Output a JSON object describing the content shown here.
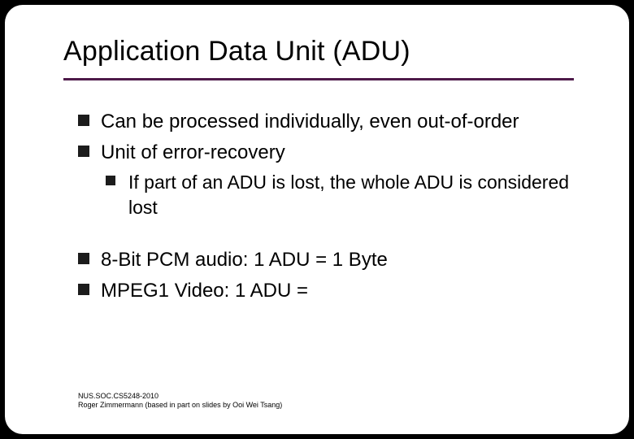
{
  "title": "Application Data Unit (ADU)",
  "bullets": {
    "b1": "Can be processed individually, even out-of-order",
    "b2": "Unit of error-recovery",
    "b2a": "If part of an ADU is lost, the whole ADU is considered lost",
    "b3": "8-Bit PCM audio:  1 ADU = 1 Byte",
    "b4": "MPEG1 Video:  1 ADU ="
  },
  "footer": {
    "line1": "NUS.SOC.CS5248-2010",
    "line2": "Roger Zimmermann (based in part on slides by Ooi Wei Tsang)"
  }
}
